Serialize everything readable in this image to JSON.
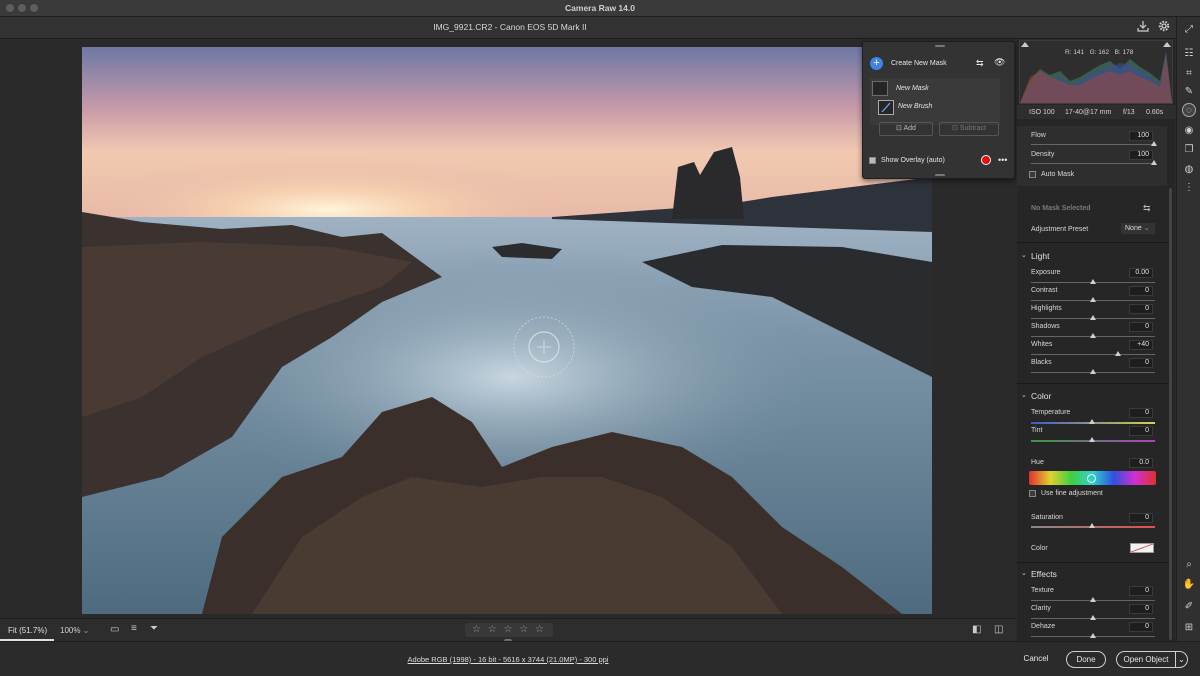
{
  "window": {
    "title": "Camera Raw 14.0"
  },
  "header": {
    "file_title": "IMG_9921.CR2  -  Canon EOS 5D Mark II"
  },
  "histogram": {
    "r_label": "R:",
    "r": "141",
    "g_label": "G:",
    "g": "162",
    "b_label": "B:",
    "b": "178"
  },
  "exif": {
    "iso": "ISO 100",
    "lens": "17-40@17 mm",
    "aperture": "f/13",
    "shutter": "0.60s"
  },
  "brush": {
    "flow_label": "Flow",
    "flow": "100",
    "density_label": "Density",
    "density": "100",
    "automask_label": "Auto Mask"
  },
  "mask_panel": {
    "status": "No Mask Selected",
    "preset_label": "Adjustment Preset",
    "preset_value": "None"
  },
  "light": {
    "title": "Light",
    "rows": [
      {
        "label": "Exposure",
        "value": "0.00",
        "pos": 0.5
      },
      {
        "label": "Contrast",
        "value": "0",
        "pos": 0.5
      },
      {
        "label": "Highlights",
        "value": "0",
        "pos": 0.5
      },
      {
        "label": "Shadows",
        "value": "0",
        "pos": 0.5
      },
      {
        "label": "Whites",
        "value": "+40",
        "pos": 0.7
      },
      {
        "label": "Blacks",
        "value": "0",
        "pos": 0.5
      }
    ]
  },
  "color": {
    "title": "Color",
    "temperature_label": "Temperature",
    "temperature": "0",
    "tint_label": "Tint",
    "tint": "0",
    "hue_label": "Hue",
    "hue": "0.0",
    "fine_label": "Use fine adjustment",
    "saturation_label": "Saturation",
    "saturation": "0",
    "color_label": "Color"
  },
  "effects": {
    "title": "Effects",
    "rows": [
      {
        "label": "Texture",
        "value": "0"
      },
      {
        "label": "Clarity",
        "value": "0"
      },
      {
        "label": "Dehaze",
        "value": "0"
      }
    ]
  },
  "flyout": {
    "create_label": "Create New Mask",
    "new_mask": "New Mask",
    "new_brush": "New Brush",
    "add_label": "Add",
    "subtract_label": "Subtract",
    "overlay_label": "Show Overlay (auto)",
    "overlay_color": "#e01010"
  },
  "toolbar": {
    "fit_label": "Fit (51.7%)",
    "zoom_label": "100%",
    "stars": "☆ ☆ ☆ ☆ ☆"
  },
  "status": {
    "workflow": "Adobe RGB (1998) - 16 bit - 5616 x 3744 (21.0MP) - 300 ppi",
    "cancel": "Cancel",
    "done": "Done",
    "open": "Open Object"
  },
  "colors": {
    "accent": "#3d84e6",
    "panel": "#262626"
  }
}
